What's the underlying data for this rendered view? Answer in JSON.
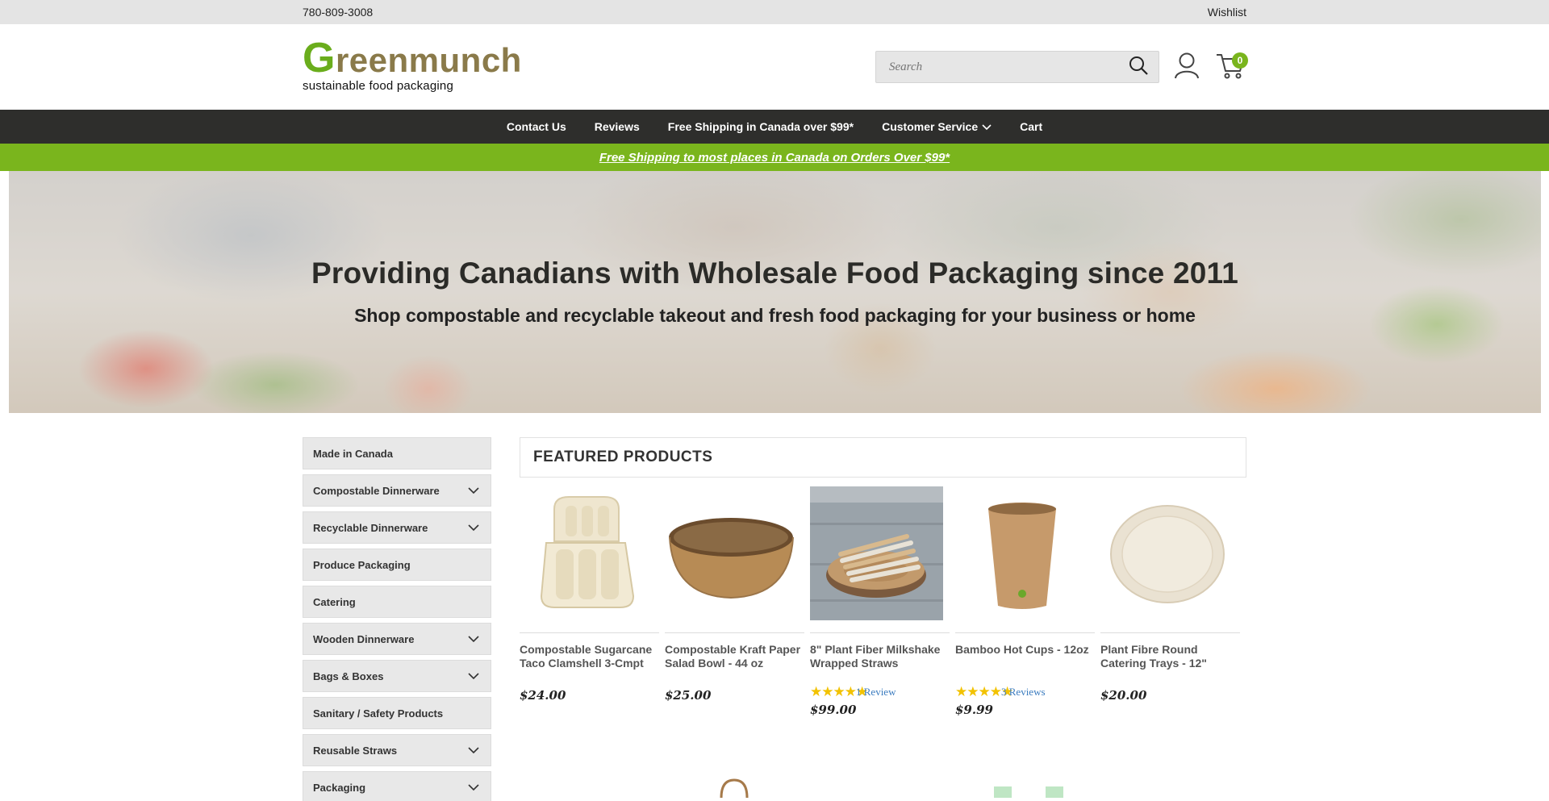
{
  "topbar": {
    "phone": "780-809-3008",
    "wishlist": "Wishlist"
  },
  "logo": {
    "g": "G",
    "reen": "reen",
    "munch": "munch",
    "tagline": "sustainable food packaging"
  },
  "search": {
    "placeholder": "Search"
  },
  "cart": {
    "count": "0"
  },
  "nav": {
    "items": [
      "Contact Us",
      "Reviews",
      "Free Shipping in Canada over $99*",
      "Customer Service",
      "Cart"
    ]
  },
  "promo": {
    "text": "Free Shipping to most places in Canada on Orders Over $99*"
  },
  "hero": {
    "title": "Providing Canadians with Wholesale Food Packaging since 2011",
    "subtitle": "Shop compostable and recyclable takeout and fresh food packaging for your business or home"
  },
  "sidebar": {
    "items": [
      {
        "label": "Made in Canada",
        "expandable": false
      },
      {
        "label": "Compostable Dinnerware",
        "expandable": true
      },
      {
        "label": "Recyclable Dinnerware",
        "expandable": true
      },
      {
        "label": "Produce Packaging",
        "expandable": false
      },
      {
        "label": "Catering",
        "expandable": false
      },
      {
        "label": "Wooden Dinnerware",
        "expandable": true
      },
      {
        "label": "Bags & Boxes",
        "expandable": true
      },
      {
        "label": "Sanitary / Safety Products",
        "expandable": false
      },
      {
        "label": "Reusable Straws",
        "expandable": true
      },
      {
        "label": "Packaging",
        "expandable": true
      }
    ]
  },
  "featured": {
    "heading": "FEATURED PRODUCTS",
    "products": [
      {
        "title": "Compostable Sugarcane Taco Clamshell 3-Cmpt",
        "price": "$24.00",
        "reviews": "",
        "stars": 0,
        "icon": "clamshell-image"
      },
      {
        "title": "Compostable Kraft Paper Salad Bowl - 44 oz",
        "price": "$25.00",
        "reviews": "",
        "stars": 0,
        "icon": "kraft-bowl-image"
      },
      {
        "title": "8\" Plant Fiber Milkshake Wrapped Straws",
        "price": "$99.00",
        "reviews": "1 Review",
        "stars": 5,
        "icon": "straws-image"
      },
      {
        "title": "Bamboo Hot Cups - 12oz",
        "price": "$9.99",
        "reviews": "3 Reviews",
        "stars": 5,
        "icon": "hot-cup-image"
      },
      {
        "title": "Plant Fibre Round Catering Trays - 12\"",
        "price": "$20.00",
        "reviews": "",
        "stars": 0,
        "icon": "round-tray-image"
      }
    ]
  },
  "colors": {
    "accent": "#7ab51d",
    "nav_bg": "#2e2e2c",
    "star": "#f2c200",
    "link": "#3a7bbf"
  }
}
